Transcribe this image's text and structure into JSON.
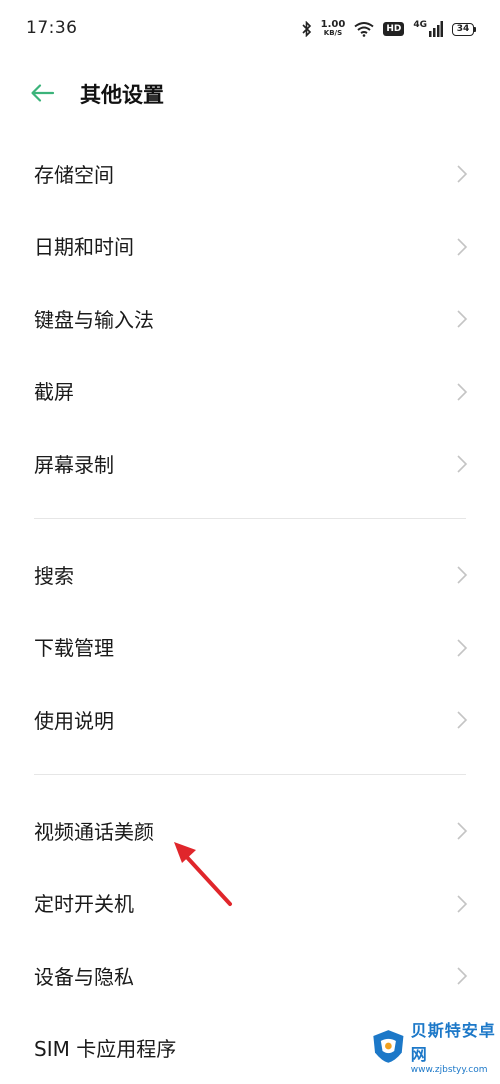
{
  "status_bar": {
    "time": "17:36",
    "net_speed_value": "1.00",
    "net_speed_unit": "KB/S",
    "hd_label": "HD",
    "signal_label": "4G",
    "battery_level": "34"
  },
  "header": {
    "back_icon": "arrow-left-icon",
    "title": "其他设置",
    "accent_color": "#3bb37a"
  },
  "sections": [
    {
      "items": [
        {
          "label": "存储空间"
        },
        {
          "label": "日期和时间"
        },
        {
          "label": "键盘与输入法"
        },
        {
          "label": "截屏"
        },
        {
          "label": "屏幕录制"
        }
      ]
    },
    {
      "items": [
        {
          "label": "搜索"
        },
        {
          "label": "下载管理"
        },
        {
          "label": "使用说明"
        }
      ]
    },
    {
      "items": [
        {
          "label": "视频通话美颜"
        },
        {
          "label": "定时开关机"
        },
        {
          "label": "设备与隐私"
        },
        {
          "label": "SIM 卡应用程序"
        }
      ]
    }
  ],
  "annotation": {
    "arrow_color": "#e0262b"
  },
  "watermark": {
    "name": "贝斯特安卓网",
    "url": "www.zjbstyy.com"
  }
}
